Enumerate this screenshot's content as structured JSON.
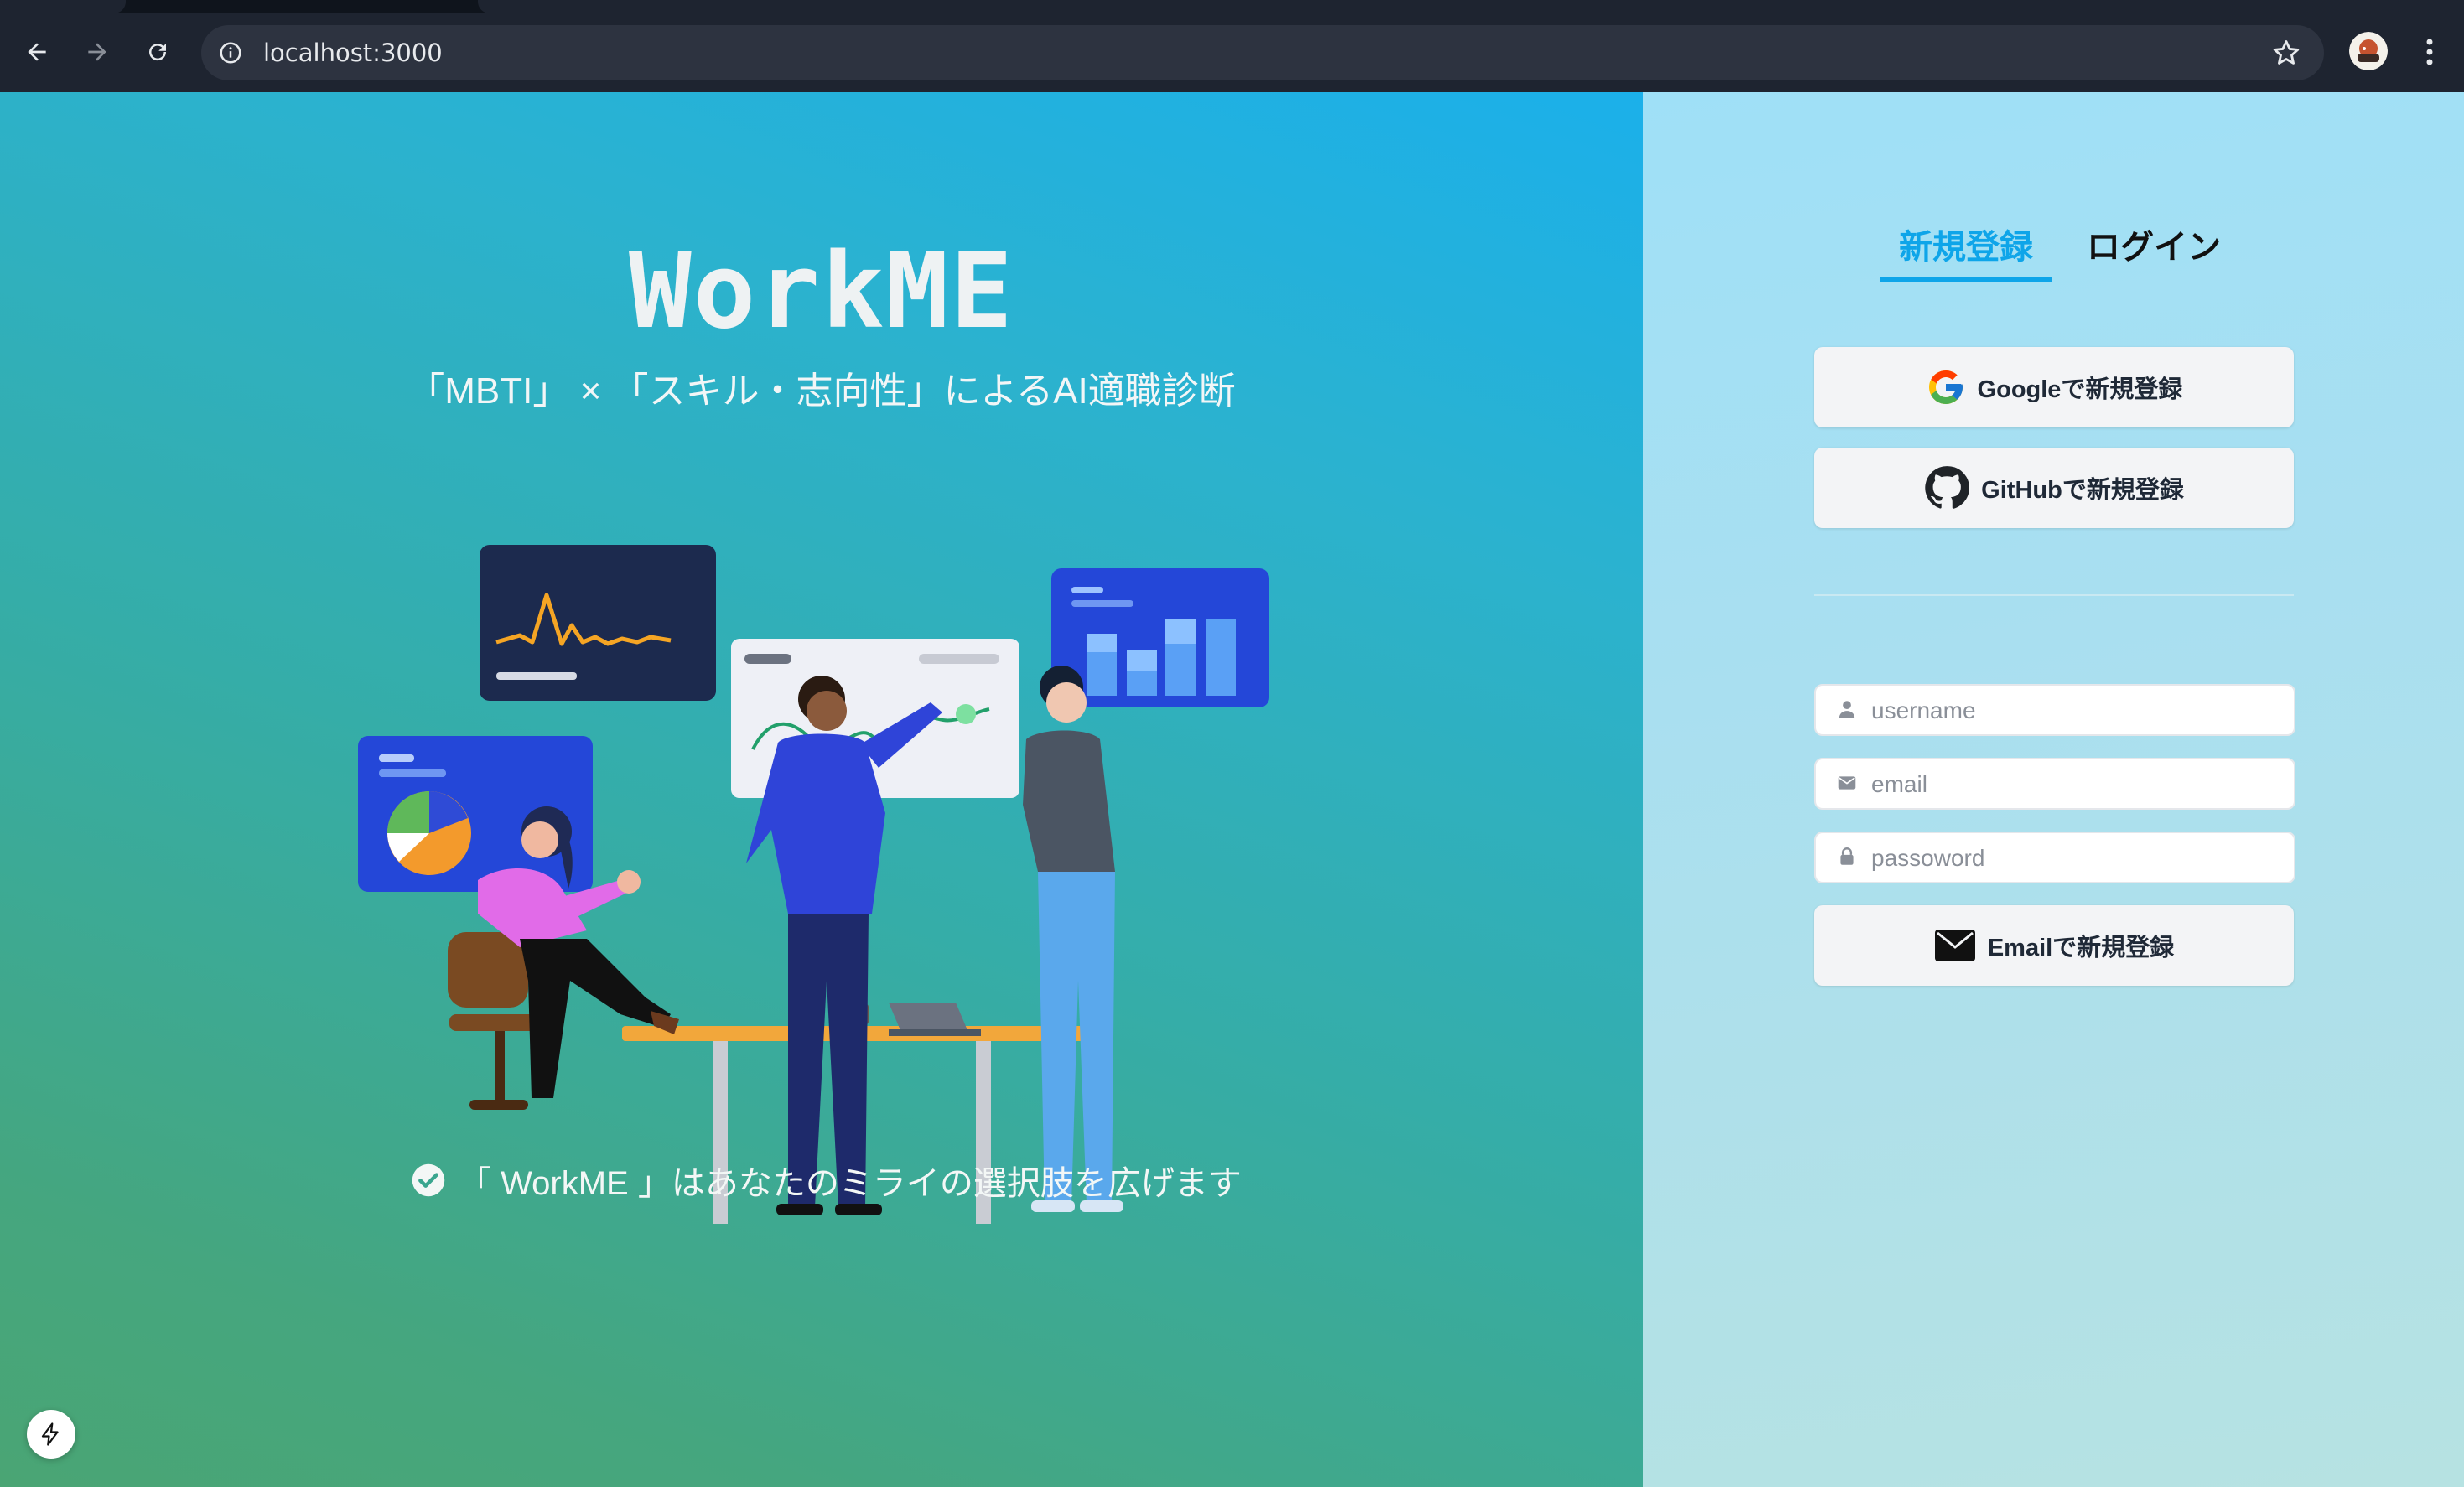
{
  "browser": {
    "url": "localhost:3000",
    "icons": [
      "back-arrow-icon",
      "forward-arrow-icon",
      "reload-icon",
      "site-info-icon",
      "bookmark-star-icon",
      "profile-avatar",
      "more-menu-icon"
    ]
  },
  "hero": {
    "title": "WorkME",
    "subtitle": "「MBTI」 × 「スキル・志向性」によるAI適職診断",
    "tagline": "「 WorkME 」はあなたのミライの選択肢を広げます"
  },
  "auth": {
    "tabs": [
      {
        "label": "新規登録",
        "active": true
      },
      {
        "label": "ログイン",
        "active": false
      }
    ],
    "google_label": "Googleで新規登録",
    "github_label": "GitHubで新規登録",
    "username_placeholder": "username",
    "email_placeholder": "email",
    "password_placeholder": "passoword",
    "email_submit_label": "Emailで新規登録"
  },
  "colors": {
    "accent": "#0ea5e9",
    "hero_top": "#1bb0ea",
    "hero_bottom": "#4aa574",
    "panel_bg": "#a9dff0"
  }
}
